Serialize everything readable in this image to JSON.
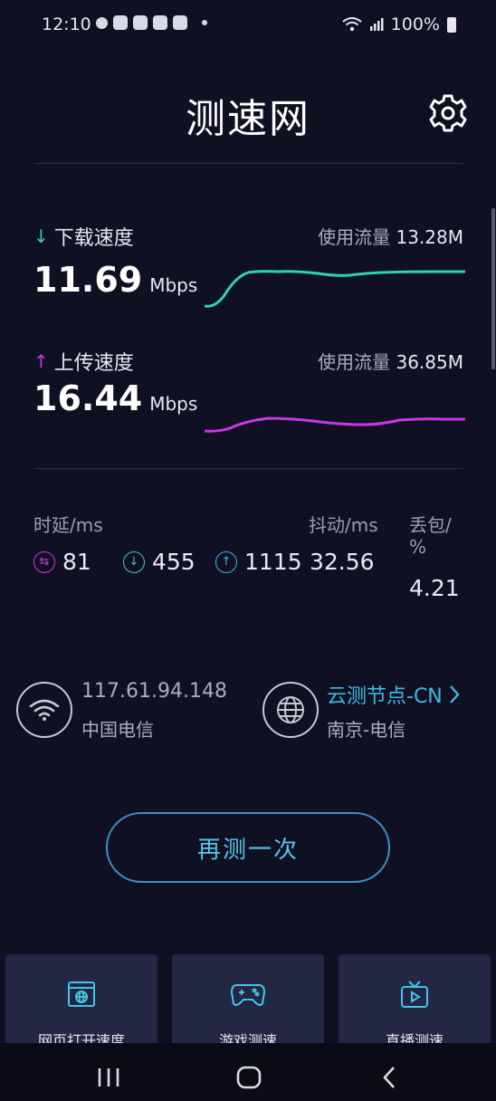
{
  "status_bar": {
    "time": "12:10",
    "battery": "100%"
  },
  "header": {
    "title": "测速网"
  },
  "download": {
    "label": "下载速度",
    "speed": "11.69",
    "unit": "Mbps",
    "usage_label": "使用流量",
    "usage_value": "13.28M"
  },
  "upload": {
    "label": "上传速度",
    "speed": "16.44",
    "unit": "Mbps",
    "usage_label": "使用流量",
    "usage_value": "36.85M"
  },
  "stats": {
    "latency_label": "时延/ms",
    "jitter_label": "抖动/ms",
    "loss_label_1": "丢包/",
    "loss_label_2": "%",
    "latency_idle": "81",
    "latency_down": "455",
    "latency_up": "1115",
    "jitter": "32.56",
    "loss": "4.21"
  },
  "network": {
    "ip": "117.61.94.148",
    "isp": "中国电信",
    "node": "云测节点-CN",
    "node_location": "南京-电信"
  },
  "retest_label": "再测一次",
  "cards": [
    {
      "label": "网页打开速度",
      "icon": "browser-icon"
    },
    {
      "label": "游戏测速",
      "icon": "gamepad-icon"
    },
    {
      "label": "直播测速",
      "icon": "tv-icon"
    }
  ],
  "colors": {
    "download": "#2fd3b4",
    "upload": "#c838e6",
    "accent": "#41b6e6"
  }
}
